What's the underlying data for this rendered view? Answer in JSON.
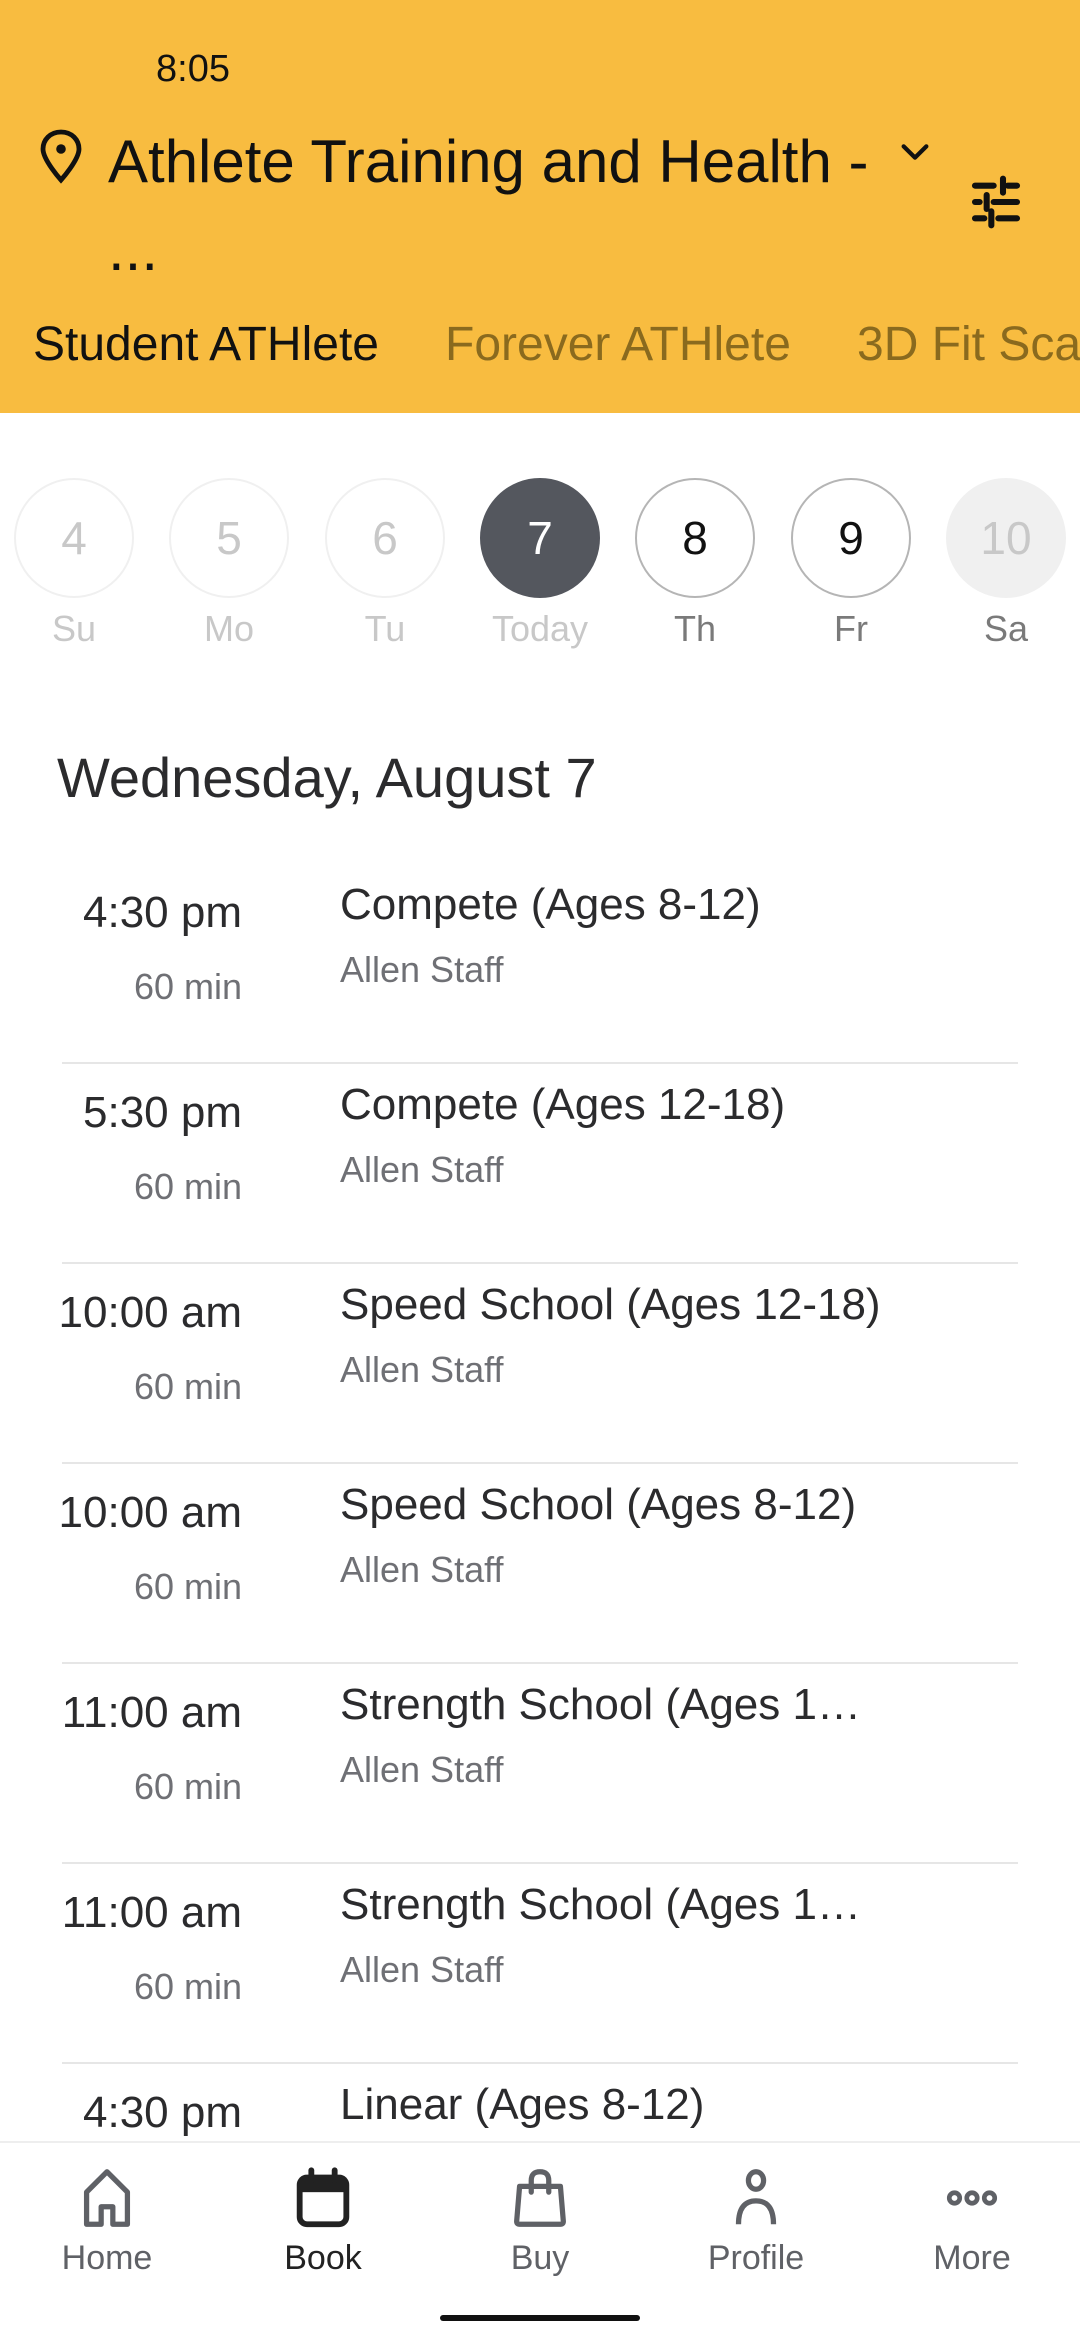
{
  "status_bar": {
    "time": "8:05"
  },
  "header": {
    "location_title": "Athlete Training and Health - ...",
    "location_icon": "map-pin-icon",
    "dropdown_icon": "chevron-down-icon",
    "filter_icon": "sliders-icon",
    "background_color": "#F8BC40"
  },
  "tabs": [
    {
      "label": "Student ATHlete",
      "active": true
    },
    {
      "label": "Forever ATHlete",
      "active": false
    },
    {
      "label": "3D Fit Sca",
      "active": false
    }
  ],
  "days": [
    {
      "number": "4",
      "label": "Su",
      "state": "past"
    },
    {
      "number": "5",
      "label": "Mo",
      "state": "past"
    },
    {
      "number": "6",
      "label": "Tu",
      "state": "past"
    },
    {
      "number": "7",
      "label": "Today",
      "state": "selected"
    },
    {
      "number": "8",
      "label": "Th",
      "state": "future"
    },
    {
      "number": "9",
      "label": "Fr",
      "state": "future"
    },
    {
      "number": "10",
      "label": "Sa",
      "state": "disabled"
    }
  ],
  "date_heading": "Wednesday, August 7",
  "classes": [
    {
      "time": "4:30 pm",
      "duration": "60 min",
      "title": "Compete (Ages 8-12)",
      "staff": "Allen Staff"
    },
    {
      "time": "5:30 pm",
      "duration": "60 min",
      "title": "Compete (Ages 12-18)",
      "staff": "Allen Staff"
    },
    {
      "time": "10:00 am",
      "duration": "60 min",
      "title": "Speed School (Ages 12-18)",
      "staff": "Allen Staff"
    },
    {
      "time": "10:00 am",
      "duration": "60 min",
      "title": "Speed School (Ages 8-12)",
      "staff": "Allen Staff"
    },
    {
      "time": "11:00 am",
      "duration": "60 min",
      "title": "Strength School (Ages 1…",
      "staff": "Allen Staff"
    },
    {
      "time": "11:00 am",
      "duration": "60 min",
      "title": "Strength School (Ages 1…",
      "staff": "Allen Staff"
    },
    {
      "time": "4:30 pm",
      "duration": "",
      "title": "Linear (Ages 8-12)",
      "staff": ""
    }
  ],
  "bottom_nav": [
    {
      "label": "Home",
      "icon": "home-icon",
      "active": false
    },
    {
      "label": "Book",
      "icon": "calendar-icon",
      "active": true
    },
    {
      "label": "Buy",
      "icon": "shopping-bag-icon",
      "active": false
    },
    {
      "label": "Profile",
      "icon": "person-icon",
      "active": false
    },
    {
      "label": "More",
      "icon": "more-dots-icon",
      "active": false
    }
  ]
}
